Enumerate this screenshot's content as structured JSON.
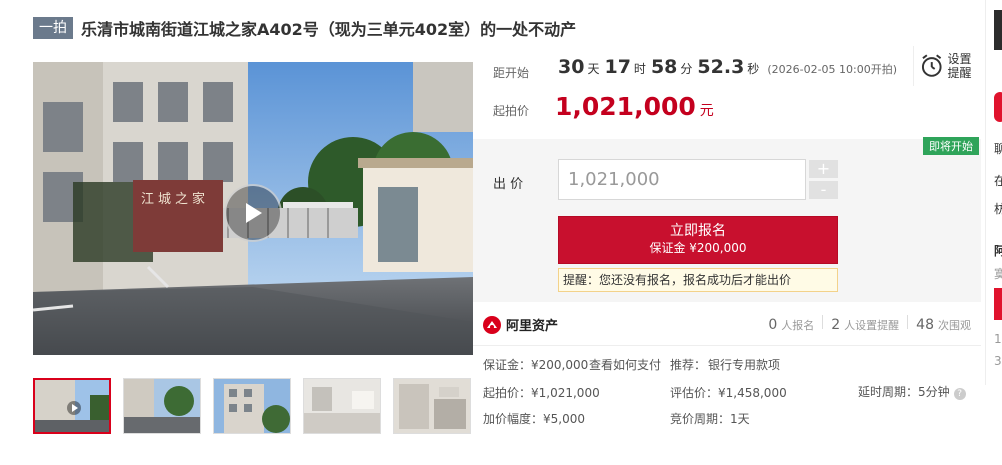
{
  "title": {
    "badge": "一拍",
    "text": "乐清市城南街道江城之家A402号（现为三单元402室）的一处不动产"
  },
  "media": {
    "gate_sign": "江城之家",
    "thumb_count": 5
  },
  "countdown": {
    "label": "距开始",
    "days": "30",
    "days_unit": "天",
    "hours": "17",
    "hours_unit": "时",
    "minutes": "58",
    "minutes_unit": "分",
    "seconds": "52.3",
    "seconds_unit": "秒",
    "start_time": "(2026-02-05 10:00开拍)"
  },
  "remind": {
    "label": "设置提醒"
  },
  "start_price": {
    "label": "起拍价",
    "value": "1,021,000",
    "unit": "元"
  },
  "bid": {
    "soon_tag": "即将开始",
    "label": "出 价",
    "input_value": "1,021,000",
    "plus": "+",
    "minus": "-",
    "signup_button": "立即报名",
    "deposit_line": "保证金 ¥200,000",
    "tip": "提醒：您还没有报名，报名成功后才能出价"
  },
  "platform": {
    "name": "阿里资产"
  },
  "stats": {
    "signed_up": "0",
    "signed_up_label": "人报名",
    "reminders": "2",
    "reminders_label": "人设置提醒",
    "views": "48",
    "views_label": "次围观"
  },
  "details": {
    "deposit": "保证金：¥200,000",
    "how_to_pay": "查看如何支付",
    "recommend_label": "推荐：",
    "recommend_link": "银行专用款项",
    "start_price": "起拍价：¥1,021,000",
    "appraisal": "评估价：¥1,458,000",
    "delay": "延时周期：5分钟",
    "increment": "加价幅度：¥5,000",
    "bid_cycle": "竞价周期：1天"
  },
  "right_strip": {
    "chars": [
      "聊",
      "在",
      "枋",
      "阿",
      "寞",
      "1",
      "3"
    ]
  },
  "colors": {
    "accent_red": "#c8102e",
    "price_red": "#c4001e",
    "badge_gray": "#6b7a8c",
    "green_tag": "#2fa45a",
    "link_blue": "#3b6cb3"
  }
}
